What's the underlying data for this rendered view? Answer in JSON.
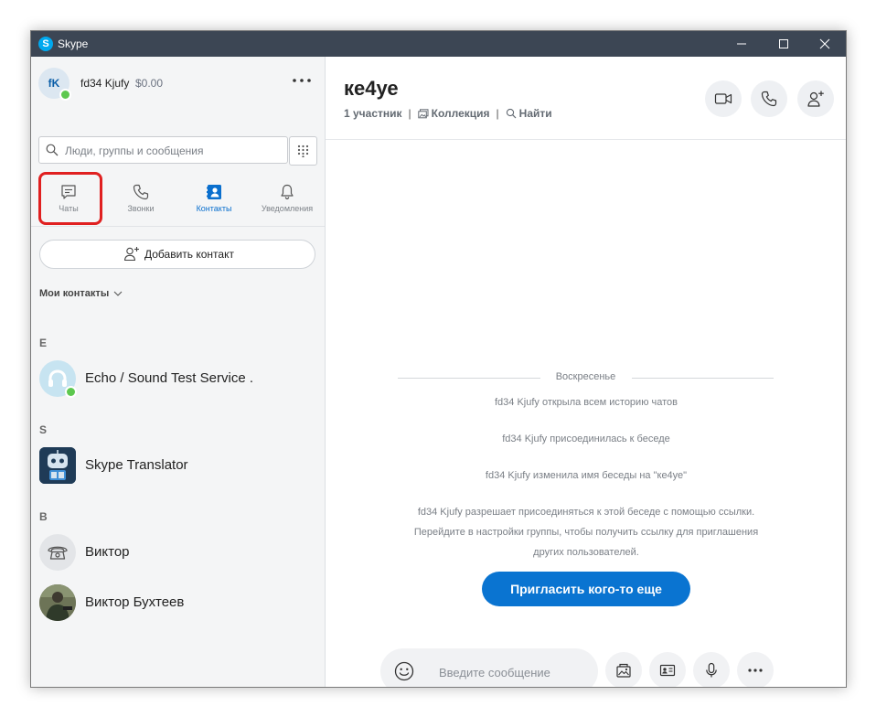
{
  "window": {
    "title": "Skype",
    "logo_letter": "S",
    "icons": [
      "minimize-icon",
      "maximize-icon",
      "close-icon"
    ]
  },
  "profile": {
    "initials": "fK",
    "name": "fd34 Kjufy",
    "balance": "$0.00",
    "status": "online"
  },
  "search": {
    "placeholder": "Люди, группы и сообщения"
  },
  "nav": {
    "tabs": [
      {
        "label": "Чаты",
        "icon": "chat-icon",
        "active": false,
        "highlighted": true
      },
      {
        "label": "Звонки",
        "icon": "phone-icon",
        "active": false
      },
      {
        "label": "Контакты",
        "icon": "contacts-icon",
        "active": true
      },
      {
        "label": "Уведомления",
        "icon": "bell-icon",
        "active": false
      }
    ]
  },
  "contacts_panel": {
    "add_contact_label": "Добавить контакт",
    "my_contacts_label": "Мои контакты",
    "sections": [
      {
        "letter": "E",
        "contacts": [
          {
            "name": "Echo / Sound Test Service .",
            "status": "online"
          }
        ]
      },
      {
        "letter": "S",
        "contacts": [
          {
            "name": "Skype Translator"
          }
        ]
      },
      {
        "letter": "В",
        "contacts": [
          {
            "name": "Виктор"
          },
          {
            "name": "Виктор Бухтеев"
          }
        ]
      }
    ]
  },
  "conversation": {
    "title": "ке4уе",
    "participants": "1 участник",
    "collection": "Коллекция",
    "find": "Найти",
    "day_label": "Воскресенье",
    "system_messages": [
      "fd34 Kjufy открыла всем историю чатов",
      "fd34 Kjufy присоединилась к беседе",
      "fd34 Kjufy изменила имя беседы на \"ке4уе\""
    ],
    "invite_info": [
      "fd34 Kjufy разрешает присоединяться к этой беседе с помощью ссылки.",
      "Перейдите в настройки группы, чтобы получить ссылку для приглашения",
      "других пользователей."
    ],
    "invite_button": "Пригласить кого-то еще",
    "composer_placeholder": "Введите сообщение"
  },
  "colors": {
    "titlebar": "#3c4654",
    "accent": "#0a74d1",
    "presence_online": "#5dc84f",
    "highlight_box": "#e02020"
  }
}
